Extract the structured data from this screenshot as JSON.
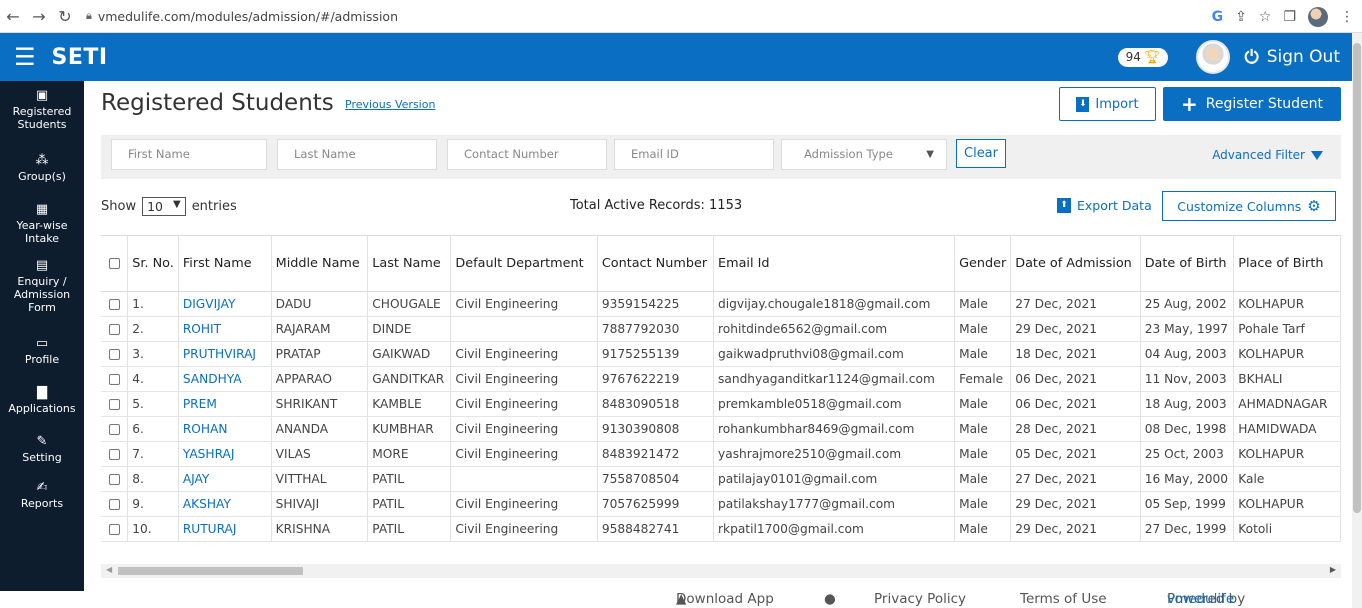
{
  "browser": {
    "url": "vmedulife.com/modules/admission/#/admission"
  },
  "header": {
    "brand": "SETI",
    "points": "94",
    "signout": "Sign Out"
  },
  "sidebar": {
    "items": [
      {
        "icon": "registered-students-icon",
        "label": "Registered Students"
      },
      {
        "icon": "groups-icon",
        "label": "Group(s)"
      },
      {
        "icon": "calendar-icon",
        "label": "Year-wise Intake"
      },
      {
        "icon": "form-icon",
        "label": "Enquiry / Admission Form"
      },
      {
        "icon": "profile-icon",
        "label": "Profile"
      },
      {
        "icon": "document-icon",
        "label": "Applications"
      },
      {
        "icon": "edit-icon",
        "label": "Setting"
      },
      {
        "icon": "reports-icon",
        "label": "Reports"
      }
    ]
  },
  "page": {
    "title": "Registered Students",
    "prev_version": "Previous Version",
    "import_label": "Import",
    "register_label": "Register Student"
  },
  "filters": {
    "first_name": "First Name",
    "last_name": "Last Name",
    "contact": "Contact Number",
    "email": "Email ID",
    "admission_type": "Admission Type",
    "clear": "Clear",
    "advanced": "Advanced Filter"
  },
  "controls": {
    "show": "Show",
    "entries_value": "10",
    "entries": "entries",
    "total": "Total Active Records: 1153",
    "export": "Export Data",
    "customize": "Customize Columns"
  },
  "table": {
    "columns": [
      "Sr. No.",
      "First Name",
      "Middle Name",
      "Last Name",
      "Default Department",
      "Contact Number",
      "Email Id",
      "Gender",
      "Date of Admission",
      "Date of Birth",
      "Place of Birth"
    ],
    "rows": [
      [
        "1.",
        "DIGVIJAY",
        "DADU",
        "CHOUGALE",
        "Civil Engineering",
        "9359154225",
        "digvijay.chougale1818@gmail.com",
        "Male",
        "27 Dec, 2021",
        "25 Aug, 2002",
        "KOLHAPUR"
      ],
      [
        "2.",
        "ROHIT",
        "RAJARAM",
        "DINDE",
        "",
        "7887792030",
        "rohitdinde6562@gmail.com",
        "Male",
        "29 Dec, 2021",
        "23 May, 1997",
        "Pohale Tarf"
      ],
      [
        "3.",
        "PRUTHVIRAJ",
        "PRATAP",
        "GAIKWAD",
        "Civil Engineering",
        "9175255139",
        "gaikwadpruthvi08@gmail.com",
        "Male",
        "18 Dec, 2021",
        "04 Aug, 2003",
        "KOLHAPUR"
      ],
      [
        "4.",
        "SANDHYA",
        "APPARAO",
        "GANDITKAR",
        "Civil Engineering",
        "9767622219",
        "sandhyaganditkar1124@gmail.com",
        "Female",
        "06 Dec, 2021",
        "11 Nov, 2003",
        "BKHALI"
      ],
      [
        "5.",
        "PREM",
        "SHRIKANT",
        "KAMBLE",
        "Civil Engineering",
        "8483090518",
        "premkamble0518@gmail.com",
        "Male",
        "06 Dec, 2021",
        "18 Aug, 2003",
        "AHMADNAGAR"
      ],
      [
        "6.",
        "ROHAN",
        "ANANDA",
        "KUMBHAR",
        "Civil Engineering",
        "9130390808",
        "rohankumbhar8469@gmail.com",
        "Male",
        "28 Dec, 2021",
        "08 Dec, 1998",
        "HAMIDWADA"
      ],
      [
        "7.",
        "YASHRAJ",
        "VILAS",
        "MORE",
        "Civil Engineering",
        "8483921472",
        "yashrajmore2510@gmail.com",
        "Male",
        "05 Dec, 2021",
        "25 Oct, 2003",
        "KOLHAPUR"
      ],
      [
        "8.",
        "AJAY",
        "VITTHAL",
        "PATIL",
        "",
        "7558708504",
        "patilajay0101@gmail.com",
        "Male",
        "27 Dec, 2021",
        "16 May, 2000",
        "Kale"
      ],
      [
        "9.",
        "AKSHAY",
        "SHIVAJI",
        "PATIL",
        "Civil Engineering",
        "7057625999",
        "patilakshay1777@gmail.com",
        "Male",
        "29 Dec, 2021",
        "05 Sep, 1999",
        "KOLHAPUR"
      ],
      [
        "10.",
        "RUTURAJ",
        "KRISHNA",
        "PATIL",
        "Civil Engineering",
        "9588482741",
        "rkpatil1700@gmail.com",
        "Male",
        "29 Dec, 2021",
        "27 Dec, 1999",
        "Kotoli"
      ]
    ]
  },
  "footer": {
    "download": "Download App",
    "privacy": "Privacy Policy",
    "terms": "Terms of Use",
    "powered": "Powered by",
    "vm": "vmedulife"
  },
  "colors": {
    "primary": "#0a6fc2",
    "sidebar": "#0d1d2e"
  }
}
